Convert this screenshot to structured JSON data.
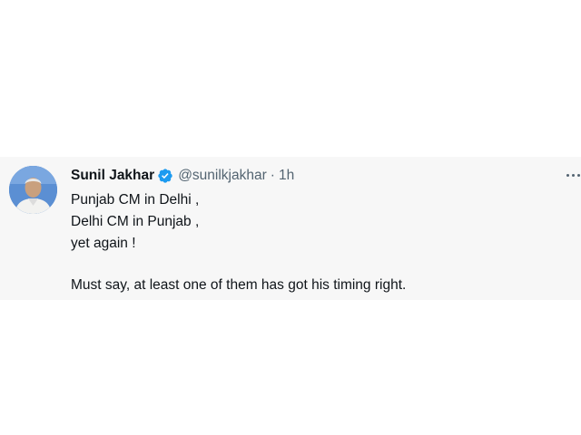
{
  "tweet": {
    "author_name": "Sunil Jakhar",
    "verified_icon": "verified-badge-icon",
    "handle": "@sunilkjakhar",
    "separator": "·",
    "time": "1h",
    "more_icon": "more-options-icon",
    "lines": [
      "Punjab CM in Delhi ,",
      "Delhi CM in Punjab ,",
      "yet again !",
      "Must say, at least one of them has got his timing right."
    ]
  },
  "colors": {
    "card_background": "#f7f7f7",
    "text": "#0f1419",
    "secondary_text": "#536471",
    "verified": "#1d9bf0"
  }
}
